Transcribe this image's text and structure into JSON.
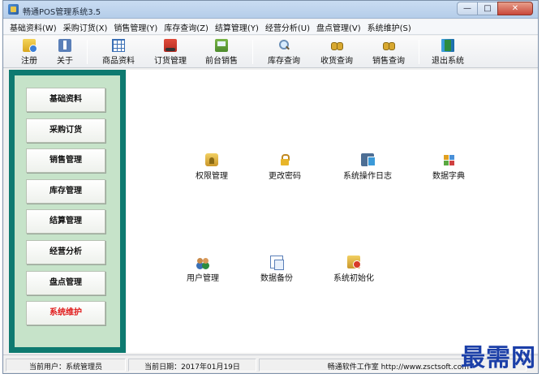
{
  "window": {
    "title": "畅通POS管理系统3.5",
    "controls": {
      "minimize": "—",
      "maximize": "□",
      "close": "✕"
    }
  },
  "menu": [
    "基础资料(W)",
    "采购订货(X)",
    "销售管理(Y)",
    "库存查询(Z)",
    "结算管理(Y)",
    "经营分析(U)",
    "盘点管理(V)",
    "系统维护(S)"
  ],
  "toolbar": [
    {
      "label": "注册",
      "icon": "register-icon"
    },
    {
      "label": "关于",
      "icon": "about-icon"
    },
    {
      "label": "商品资料",
      "icon": "product-grid-icon"
    },
    {
      "label": "订货管理",
      "icon": "order-truck-icon"
    },
    {
      "label": "前台销售",
      "icon": "pos-register-icon"
    },
    {
      "label": "库存查询",
      "icon": "magnifier-icon"
    },
    {
      "label": "收货查询",
      "icon": "binoculars-icon"
    },
    {
      "label": "销售查询",
      "icon": "binoculars-icon"
    },
    {
      "label": "退出系统",
      "icon": "exit-door-icon"
    }
  ],
  "sidebar": [
    {
      "label": "基础资料",
      "active": false
    },
    {
      "label": "采购订货",
      "active": false
    },
    {
      "label": "销售管理",
      "active": false
    },
    {
      "label": "库存管理",
      "active": false
    },
    {
      "label": "结算管理",
      "active": false
    },
    {
      "label": "经营分析",
      "active": false
    },
    {
      "label": "盘点管理",
      "active": false
    },
    {
      "label": "系统维护",
      "active": true
    }
  ],
  "content": [
    {
      "label": "权限管理",
      "icon": "permission-icon"
    },
    {
      "label": "更改密码",
      "icon": "lock-icon"
    },
    {
      "label": "系统操作日志",
      "icon": "log-computer-icon"
    },
    {
      "label": "数据字典",
      "icon": "dictionary-icon"
    },
    {
      "label": "用户管理",
      "icon": "users-icon"
    },
    {
      "label": "数据备份",
      "icon": "backup-icon"
    },
    {
      "label": "系统初始化",
      "icon": "initialize-icon"
    }
  ],
  "status": {
    "current_user": "当前用户：系统管理员",
    "current_date": "当前日期：2017年01月19日",
    "company": "畅通软件工作室 http://www.zsctsoft.com"
  },
  "colors": {
    "panel_frame": "#0e7a70",
    "panel_fill": "#c6e3c9",
    "active_text": "#e01818",
    "watermark": "#1b3fa8"
  },
  "watermark": "最需网"
}
